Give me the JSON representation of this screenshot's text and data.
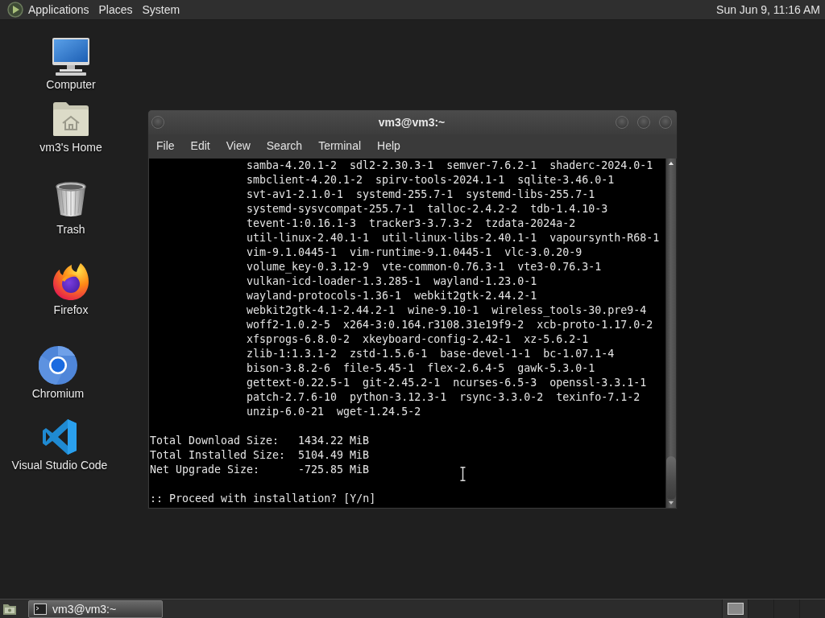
{
  "top_panel": {
    "menus": [
      "Applications",
      "Places",
      "System"
    ],
    "clock": "Sun Jun 9, 11:16 AM"
  },
  "desktop_icons": [
    {
      "kind": "computer",
      "label": "Computer"
    },
    {
      "kind": "home",
      "label": "vm3's Home"
    },
    {
      "kind": "trash",
      "label": "Trash"
    },
    {
      "kind": "firefox",
      "label": "Firefox"
    },
    {
      "kind": "chromium",
      "label": "Chromium"
    },
    {
      "kind": "vscode",
      "label": "Visual Studio Code"
    }
  ],
  "terminal": {
    "title": "vm3@vm3:~",
    "menu": [
      "File",
      "Edit",
      "View",
      "Search",
      "Terminal",
      "Help"
    ],
    "package_lines": [
      "samba-4.20.1-2  sdl2-2.30.3-1  semver-7.6.2-1  shaderc-2024.0-1",
      "smbclient-4.20.1-2  spirv-tools-2024.1-1  sqlite-3.46.0-1",
      "svt-av1-2.1.0-1  systemd-255.7-1  systemd-libs-255.7-1",
      "systemd-sysvcompat-255.7-1  talloc-2.4.2-2  tdb-1.4.10-3",
      "tevent-1:0.16.1-3  tracker3-3.7.3-2  tzdata-2024a-2",
      "util-linux-2.40.1-1  util-linux-libs-2.40.1-1  vapoursynth-R68-1",
      "vim-9.1.0445-1  vim-runtime-9.1.0445-1  vlc-3.0.20-9",
      "volume_key-0.3.12-9  vte-common-0.76.3-1  vte3-0.76.3-1",
      "vulkan-icd-loader-1.3.285-1  wayland-1.23.0-1",
      "wayland-protocols-1.36-1  webkit2gtk-2.44.2-1",
      "webkit2gtk-4.1-2.44.2-1  wine-9.10-1  wireless_tools-30.pre9-4",
      "woff2-1.0.2-5  x264-3:0.164.r3108.31e19f9-2  xcb-proto-1.17.0-2",
      "xfsprogs-6.8.0-2  xkeyboard-config-2.42-1  xz-5.6.2-1",
      "zlib-1:1.3.1-2  zstd-1.5.6-1  base-devel-1-1  bc-1.07.1-4",
      "bison-3.8.2-6  file-5.45-1  flex-2.6.4-5  gawk-5.3.0-1",
      "gettext-0.22.5-1  git-2.45.2-1  ncurses-6.5-3  openssl-3.3.1-1",
      "patch-2.7.6-10  python-3.12.3-1  rsync-3.3.0-2  texinfo-7.1-2",
      "unzip-6.0-21  wget-1.24.5-2"
    ],
    "summary": [
      {
        "label": "Total Download Size:",
        "value": "1434.22 MiB"
      },
      {
        "label": "Total Installed Size:",
        "value": "5104.49 MiB"
      },
      {
        "label": "Net Upgrade Size:",
        "value": "-725.85 MiB"
      }
    ],
    "prompt": ":: Proceed with installation? [Y/n]"
  },
  "taskbar": {
    "tasks": [
      {
        "label": "vm3@vm3:~",
        "selected": true
      }
    ],
    "workspaces": [
      {
        "selected": true
      },
      {
        "selected": false
      },
      {
        "selected": false
      },
      {
        "selected": false
      }
    ]
  }
}
